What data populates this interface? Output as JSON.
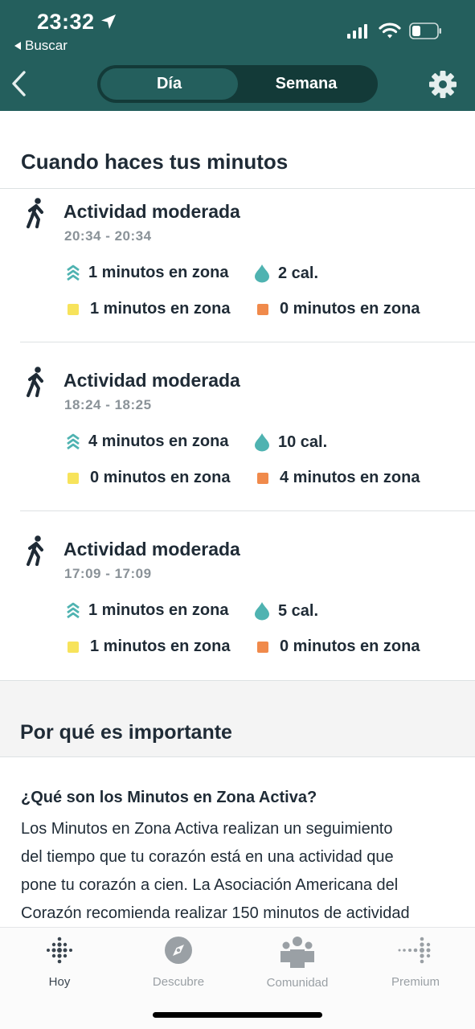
{
  "status_bar": {
    "time": "23:32",
    "back_app": "Buscar"
  },
  "nav": {
    "segments": [
      "Día",
      "Semana"
    ],
    "selected": "Día"
  },
  "minutes_section": {
    "title": "Cuando haces tus minutos",
    "activities": [
      {
        "name": "Actividad moderada",
        "time": "20:34 - 20:34",
        "zone_minutes": "1 minutos en zona",
        "calories": "2 cal.",
        "fat_burn": "1 minutos en zona",
        "cardio": "0 minutos en zona"
      },
      {
        "name": "Actividad moderada",
        "time": "18:24 - 18:25",
        "zone_minutes": "4 minutos en zona",
        "calories": "10 cal.",
        "fat_burn": "0 minutos en zona",
        "cardio": "4 minutos en zona"
      },
      {
        "name": "Actividad moderada",
        "time": "17:09 - 17:09",
        "zone_minutes": "1 minutos en zona",
        "calories": "5 cal.",
        "fat_burn": "1 minutos en zona",
        "cardio": "0 minutos en zona"
      }
    ]
  },
  "why_section": {
    "title": "Por qué es importante",
    "question": "¿Qué son los Minutos en Zona Activa?",
    "lines": [
      "Los Minutos en Zona Activa realizan un seguimiento",
      "del tiempo que tu corazón está en una actividad que",
      "pone tu corazón a cien. La Asociación Americana del",
      "Corazón recomienda realizar 150 minutos de actividad"
    ]
  },
  "tabbar": {
    "items": [
      "Hoy",
      "Descubre",
      "Comunidad",
      "Premium"
    ],
    "active": "Hoy"
  },
  "colors": {
    "header": "#245f5d",
    "segment_track": "#133a38",
    "zone_teal": "#4fb3b1",
    "fat_burn_yellow": "#f7e35b",
    "cardio_orange": "#f08a4b"
  },
  "icons": {
    "activity": "walking-person-icon",
    "zone": "zone-chevrons-icon",
    "calories": "flame-drop-icon"
  }
}
